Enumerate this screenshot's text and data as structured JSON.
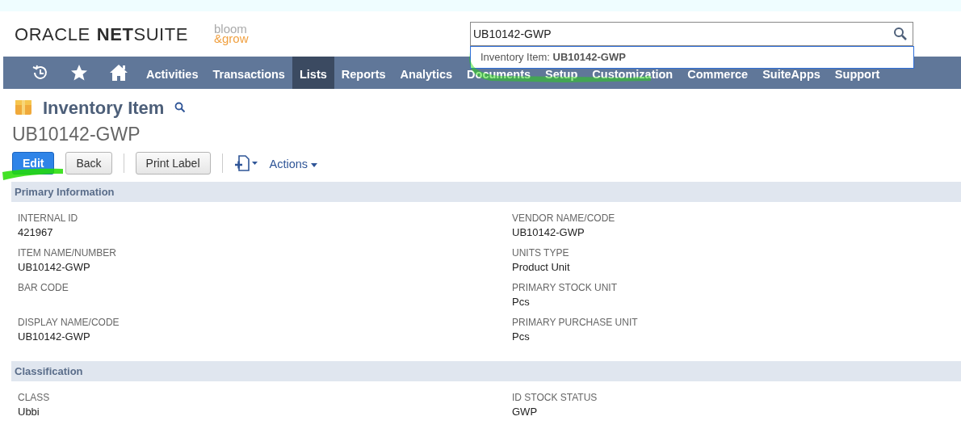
{
  "header": {
    "brand_oracle": "ORACLE",
    "brand_netsuite_bold": "NET",
    "brand_netsuite": "SUITE",
    "company_logo_top": "bloom",
    "company_logo_bottom": "&grow"
  },
  "search": {
    "value": "UB10142-GWP",
    "suggestions": [
      {
        "label": "Inventory Item: **UB10142-GWP**"
      }
    ]
  },
  "nav": [
    {
      "kind": "icon",
      "selected": false
    },
    {
      "kind": "icon",
      "selected": false
    },
    {
      "kind": "icon",
      "selected": false
    },
    {
      "kind": "text",
      "label": "Activities",
      "selected": false
    },
    {
      "kind": "text",
      "label": "Transactions",
      "selected": false
    },
    {
      "kind": "text",
      "label": "Lists",
      "selected": true
    },
    {
      "kind": "text",
      "label": "Reports",
      "selected": false
    },
    {
      "kind": "text",
      "label": "Analytics",
      "selected": false
    },
    {
      "kind": "text",
      "label": "Documents",
      "selected": false
    },
    {
      "kind": "text",
      "label": "Setup",
      "selected": false
    },
    {
      "kind": "text",
      "label": "Customization",
      "selected": false
    },
    {
      "kind": "text",
      "label": "Commerce",
      "selected": false
    },
    {
      "kind": "text",
      "label": "SuiteApps",
      "selected": false
    },
    {
      "kind": "text",
      "label": "Support",
      "selected": false
    }
  ],
  "page": {
    "record_type": "Inventory Item",
    "record_name": "UB10142-GWP"
  },
  "toolbar": [
    {
      "kind": "primary",
      "label": "Edit"
    },
    {
      "kind": "button",
      "label": "Back"
    },
    {
      "kind": "divider"
    },
    {
      "kind": "button",
      "label": "Print Label"
    },
    {
      "kind": "divider"
    },
    {
      "kind": "new-menu"
    },
    {
      "kind": "menu",
      "label": "Actions"
    }
  ],
  "sections": [
    {
      "title": "Primary Information",
      "left": [
        {
          "label": "INTERNAL ID",
          "value": "421967"
        },
        {
          "label": "ITEM NAME/NUMBER",
          "value": "UB10142-GWP"
        },
        {
          "label": "BAR CODE"
        },
        {
          "label": "DISPLAY NAME/CODE",
          "value": "UB10142-GWP"
        }
      ],
      "right": [
        {
          "label": "VENDOR NAME/CODE",
          "value": "UB10142-GWP"
        },
        {
          "label": "UNITS TYPE",
          "value": "Product Unit"
        },
        {
          "label": "PRIMARY STOCK UNIT",
          "value": "Pcs"
        },
        {
          "label": "PRIMARY PURCHASE UNIT",
          "value": "Pcs"
        }
      ]
    },
    {
      "title": "Classification",
      "left": [
        {
          "label": "CLASS",
          "value": "Ubbi"
        }
      ],
      "right": [
        {
          "label": "ID STOCK STATUS",
          "value": "GWP"
        }
      ]
    }
  ]
}
